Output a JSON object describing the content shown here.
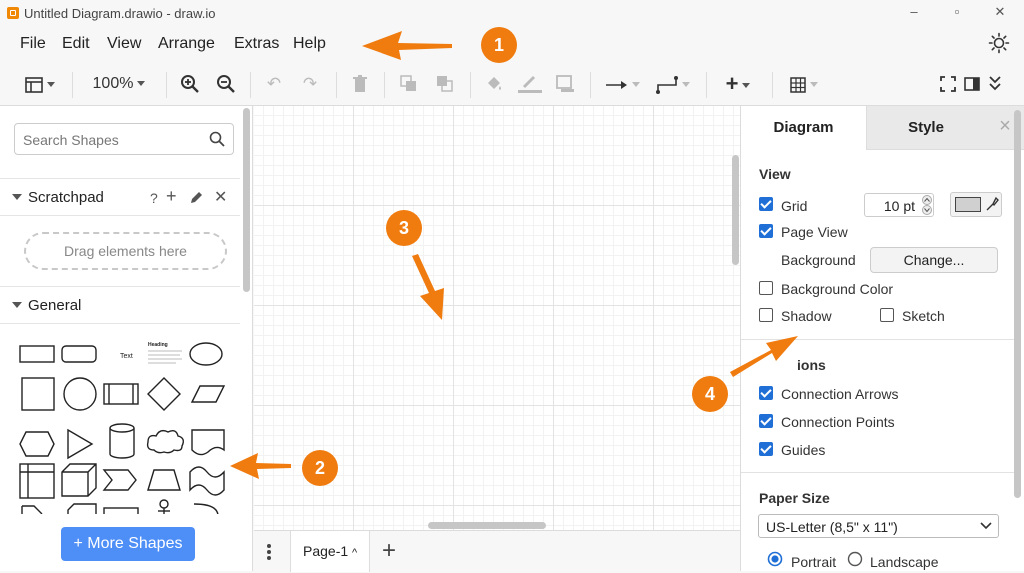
{
  "window": {
    "title": "Untitled Diagram.drawio - draw.io",
    "controls": {
      "minimize": "–",
      "maximize": "▫",
      "close": "✕"
    }
  },
  "menu": {
    "items": [
      "File",
      "Edit",
      "View",
      "Arrange",
      "Extras",
      "Help"
    ]
  },
  "toolbar": {
    "zoom": "100%"
  },
  "sidebar": {
    "search_placeholder": "Search Shapes",
    "scratchpad": {
      "label": "Scratchpad",
      "help": "?",
      "drop_hint": "Drag elements here"
    },
    "general": {
      "label": "General",
      "shape_text": "Text",
      "shape_heading": "Heading"
    },
    "more_shapes": "+ More Shapes"
  },
  "pages": {
    "tab": "Page-1",
    "add": "+"
  },
  "format_panel": {
    "tabs": [
      "Diagram",
      "Style"
    ],
    "close": "×",
    "view": {
      "heading": "View",
      "grid_label": "Grid",
      "grid_checked": true,
      "grid_size": "10 pt",
      "page_view_label": "Page View",
      "page_view_checked": true,
      "background_label": "Background",
      "change_button": "Change...",
      "background_color_label": "Background Color",
      "background_color_checked": false,
      "shadow_label": "Shadow",
      "shadow_checked": false,
      "sketch_label": "Sketch",
      "sketch_checked": false
    },
    "options": {
      "heading": "ions",
      "connection_arrows": "Connection Arrows",
      "connection_points": "Connection Points",
      "guides": "Guides"
    },
    "paper": {
      "heading": "Paper Size",
      "selected": "US-Letter (8,5\" x 11\")",
      "portrait": "Portrait",
      "landscape": "Landscape",
      "orientation": "Portrait"
    }
  },
  "callouts": [
    "1",
    "2",
    "3",
    "4"
  ],
  "colors": {
    "accent": "#1f6fd6",
    "callout": "#f07b0e",
    "more_shapes_button": "#4d8ef7"
  }
}
